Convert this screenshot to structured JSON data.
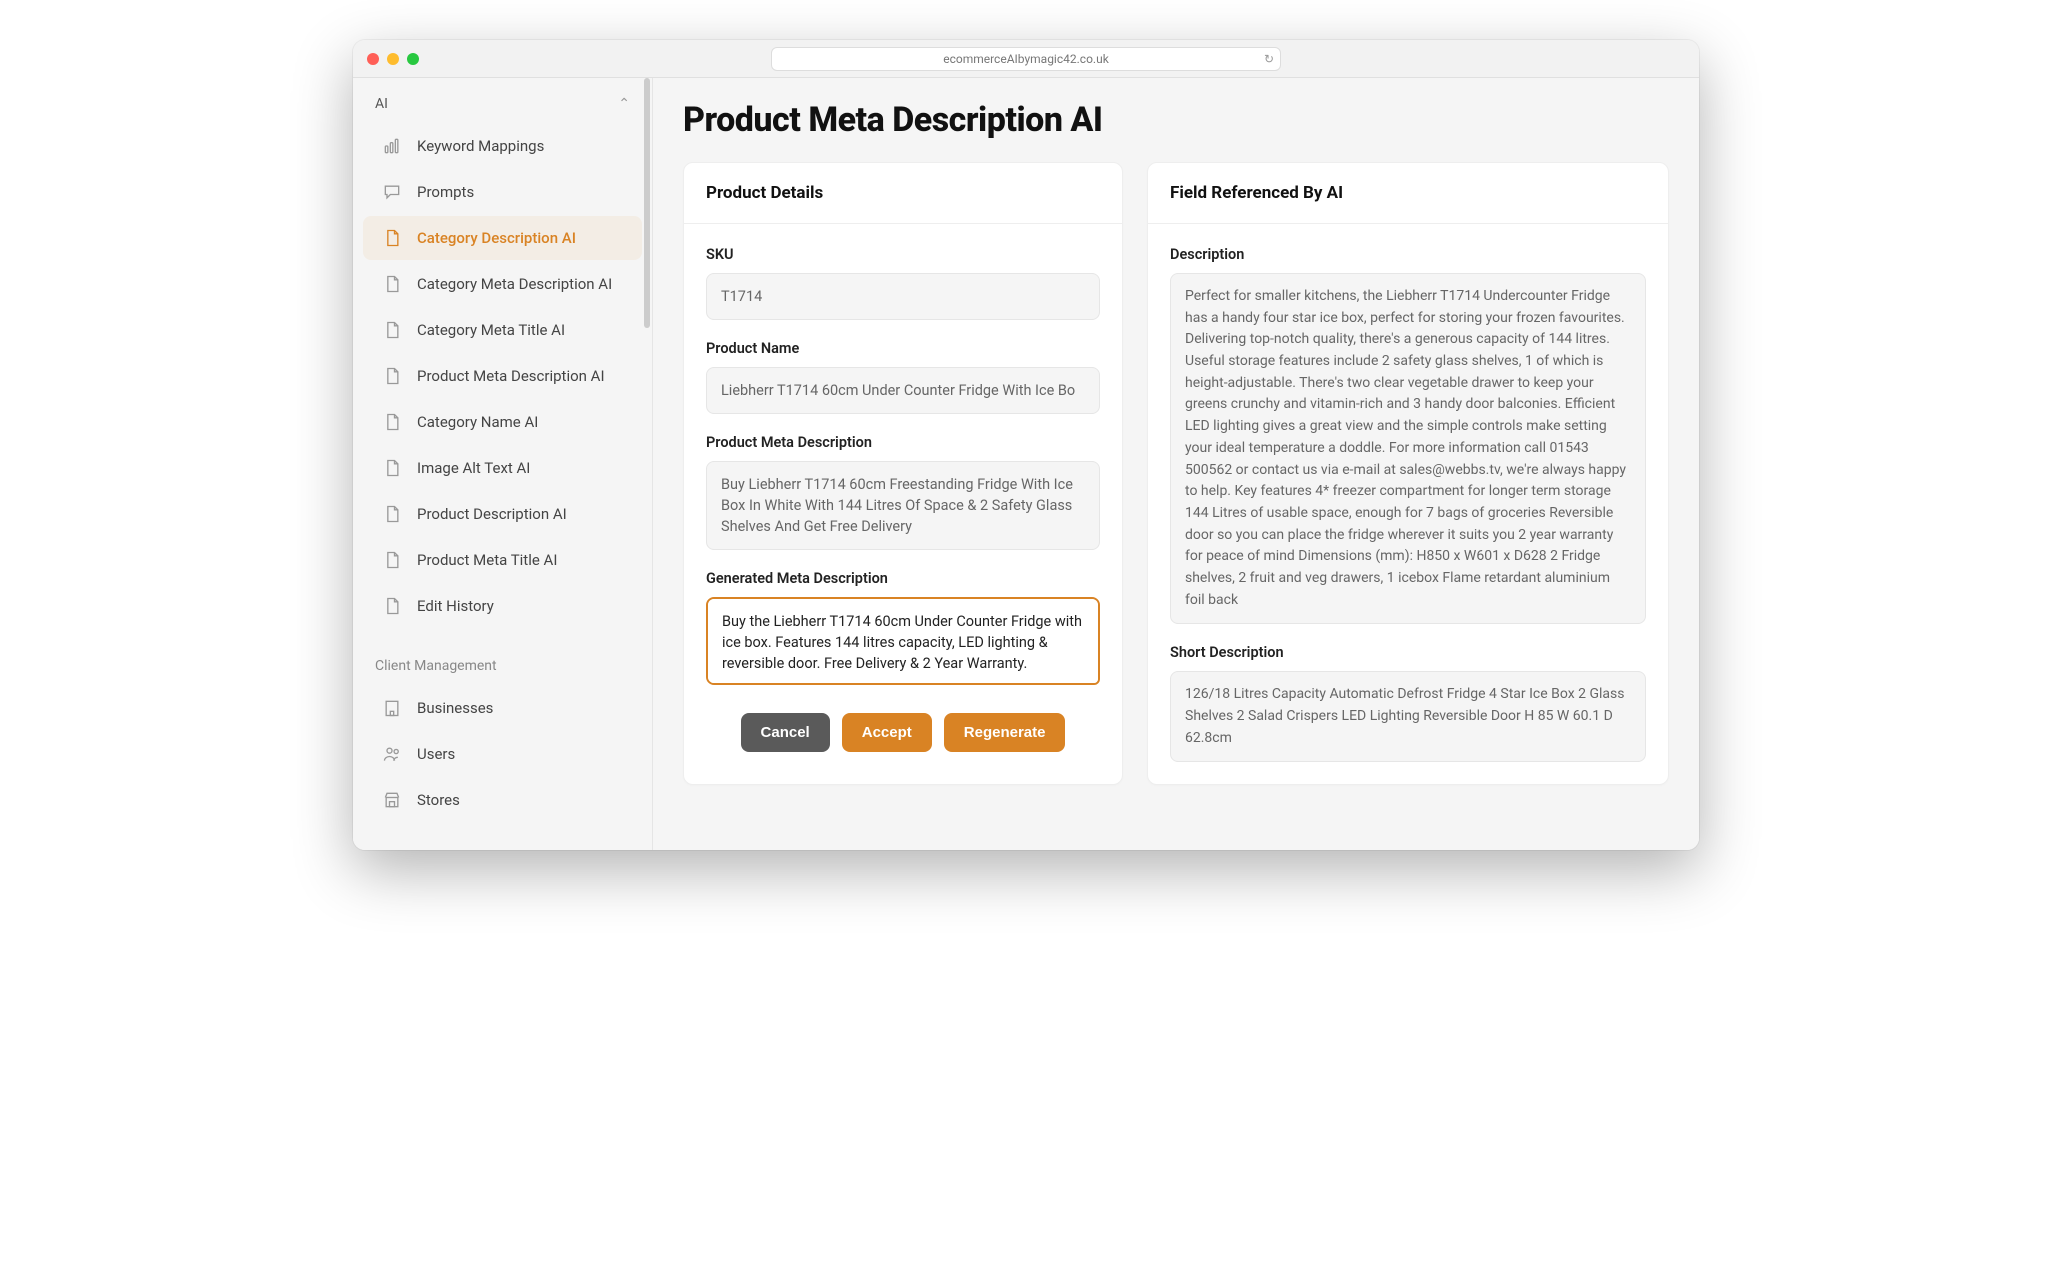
{
  "browser": {
    "url": "ecommerceAIbymagic42.co.uk"
  },
  "sidebar": {
    "section_label": "AI",
    "items": [
      {
        "label": "Keyword Mappings",
        "icon": "bars-icon"
      },
      {
        "label": "Prompts",
        "icon": "chat-icon"
      },
      {
        "label": "Category Description AI",
        "icon": "doc-icon",
        "active": true
      },
      {
        "label": "Category Meta Description AI",
        "icon": "doc-icon"
      },
      {
        "label": "Category Meta Title AI",
        "icon": "doc-icon"
      },
      {
        "label": "Product Meta Description AI",
        "icon": "doc-icon"
      },
      {
        "label": "Category Name AI",
        "icon": "doc-icon"
      },
      {
        "label": "Image Alt Text AI",
        "icon": "doc-icon"
      },
      {
        "label": "Product Description AI",
        "icon": "doc-icon"
      },
      {
        "label": "Product Meta Title AI",
        "icon": "doc-icon"
      },
      {
        "label": "Edit History",
        "icon": "doc-icon"
      }
    ],
    "group2_label": "Client Management",
    "group2_items": [
      {
        "label": "Businesses",
        "icon": "building-icon"
      },
      {
        "label": "Users",
        "icon": "users-icon"
      },
      {
        "label": "Stores",
        "icon": "store-icon"
      }
    ]
  },
  "page": {
    "title": "Product Meta Description AI"
  },
  "details": {
    "header": "Product Details",
    "sku_label": "SKU",
    "sku_value": "T1714",
    "name_label": "Product Name",
    "name_value": "Liebherr T1714 60cm Under Counter Fridge With Ice Bo",
    "meta_label": "Product Meta Description",
    "meta_value": "Buy Liebherr T1714 60cm Freestanding Fridge With Ice Box In White With 144 Litres Of Space & 2 Safety Glass Shelves And Get Free Delivery",
    "gen_label": "Generated Meta Description",
    "gen_value": "Buy the Liebherr T1714 60cm Under Counter Fridge with ice box. Features 144 litres capacity, LED lighting & reversible door. Free Delivery & 2 Year Warranty."
  },
  "actions": {
    "cancel": "Cancel",
    "accept": "Accept",
    "regenerate": "Regenerate"
  },
  "reference": {
    "header": "Field Referenced By AI",
    "desc_label": "Description",
    "desc_value": "Perfect for smaller kitchens, the Liebherr T1714 Undercounter Fridge has a handy four star ice box, perfect for storing your frozen favourites. Delivering top-notch quality, there's a generous capacity of 144 litres. Useful storage features include 2 safety glass shelves, 1 of which is height-adjustable. There's two clear vegetable drawer to keep your greens crunchy and vitamin-rich and 3 handy door balconies. Efficient LED lighting gives a great view and the simple controls make setting your ideal temperature a doddle. For more information call 01543 500562 or contact us via e-mail at sales@webbs.tv, we're always happy to help. Key features 4* freezer compartment for longer term storage 144 Litres of usable space, enough for 7 bags of groceries Reversible door so you can place the fridge wherever it suits you 2 year warranty for peace of mind Dimensions (mm): H850 x W601 x D628 2 Fridge shelves, 2 fruit and veg drawers, 1 icebox Flame retardant aluminium foil back",
    "short_label": "Short Description",
    "short_value": "126/18 Litres Capacity Automatic Defrost Fridge 4 Star Ice Box 2 Glass Shelves 2 Salad Crispers LED Lighting Reversible Door H 85  W 60.1  D 62.8cm"
  }
}
